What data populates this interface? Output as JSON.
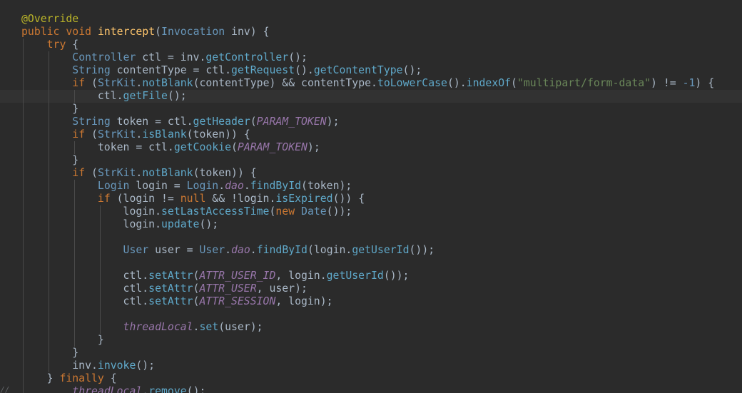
{
  "editor": {
    "lines": [
      "@Override",
      "public void intercept(Invocation inv) {",
      "    try {",
      "        Controller ctl = inv.getController();",
      "        String contentType = ctl.getRequest().getContentType();",
      "        if (StrKit.notBlank(contentType) && contentType.toLowerCase().indexOf(\"multipart/form-data\") != -1) {",
      "            ctl.getFile();",
      "        }",
      "        String token = ctl.getHeader(PARAM_TOKEN);",
      "        if (StrKit.isBlank(token)) {",
      "            token = ctl.getCookie(PARAM_TOKEN);",
      "        }",
      "        if (StrKit.notBlank(token)) {",
      "            Login login = Login.dao.findById(token);",
      "            if (login != null && !login.isExpired()) {",
      "                login.setLastAccessTime(new Date());",
      "                login.update();",
      "",
      "                User user = User.dao.findById(login.getUserId());",
      "",
      "                ctl.setAttr(ATTR_USER_ID, login.getUserId());",
      "                ctl.setAttr(ATTR_USER, user);",
      "                ctl.setAttr(ATTR_SESSION, login);",
      "",
      "                threadLocal.set(user);",
      "            }",
      "        }",
      "        inv.invoke();",
      "    } finally {",
      "        threadLocal.remove();"
    ],
    "gutter_marker": "//"
  },
  "colors": {
    "background": "#2b2b2b",
    "default_text": "#a9b7c6",
    "keyword": "#cc7832",
    "annotation": "#bbb529",
    "method_declaration": "#ffc66d",
    "method_call": "#5fa8c9",
    "string": "#6a8759",
    "number": "#6897bb",
    "static_field": "#9876aa"
  }
}
